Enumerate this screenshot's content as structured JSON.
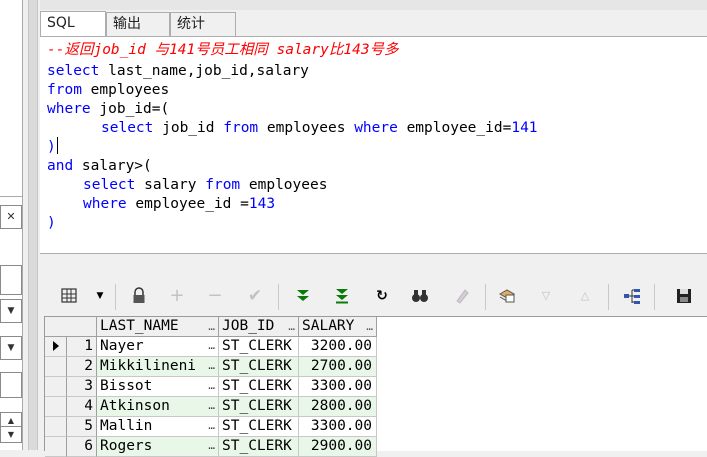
{
  "left_dock": {
    "close_glyph": "✕",
    "spinner_up": "▲",
    "spinner_down": "▼"
  },
  "tabs": [
    {
      "label": "SQL",
      "active": true
    },
    {
      "label": "输出",
      "active": false
    },
    {
      "label": "统计",
      "active": false
    }
  ],
  "editor": {
    "comment": "--返回job_id 与141号员工相同 salary比143号多",
    "l2": {
      "kw": "select",
      "rest": " last_name,job_id,salary"
    },
    "l3": {
      "kw": "from",
      "rest": " employees"
    },
    "l4": {
      "kw": "where",
      "rest": " job_id=("
    },
    "l5": {
      "kw1": "select",
      "t1": " job_id ",
      "kw2": "from",
      "t2": " employees ",
      "kw3": "where",
      "t3": " employee_id=",
      "num": "141"
    },
    "l6": ")",
    "l7": {
      "kw": "and",
      "rest": " salary>("
    },
    "l8": {
      "kw1": "select",
      "t1": " salary ",
      "kw2": "from",
      "t2": " employees"
    },
    "l9": {
      "kw": "where",
      "t": " employee_id =",
      "num": "143"
    },
    "l10": ")"
  },
  "colors": {
    "keyword": "#0000ff",
    "comment": "#ff0000",
    "alt_row": "#e8f7e8"
  },
  "toolbar": {
    "icons": [
      "grid-menu-icon",
      "lock-icon",
      "add-record-icon",
      "delete-record-icon",
      "post-record-icon",
      "fetch-next-icon",
      "fetch-all-icon",
      "refresh-icon",
      "find-icon",
      "clear-icon",
      "query-by-example-icon",
      "filter-down-icon",
      "filter-up-icon",
      "export-tree-icon",
      "save-icon"
    ]
  },
  "grid": {
    "columns": [
      "LAST_NAME",
      "JOB_ID",
      "SALARY"
    ],
    "rows": [
      {
        "num": "1",
        "last_name": "Nayer",
        "job_id": "ST_CLERK",
        "salary": "3200.00"
      },
      {
        "num": "2",
        "last_name": "Mikkilineni",
        "job_id": "ST_CLERK",
        "salary": "2700.00"
      },
      {
        "num": "3",
        "last_name": "Bissot",
        "job_id": "ST_CLERK",
        "salary": "3300.00"
      },
      {
        "num": "4",
        "last_name": "Atkinson",
        "job_id": "ST_CLERK",
        "salary": "2800.00"
      },
      {
        "num": "5",
        "last_name": "Mallin",
        "job_id": "ST_CLERK",
        "salary": "3300.00"
      },
      {
        "num": "6",
        "last_name": "Rogers",
        "job_id": "ST_CLERK",
        "salary": "2900.00"
      }
    ]
  }
}
